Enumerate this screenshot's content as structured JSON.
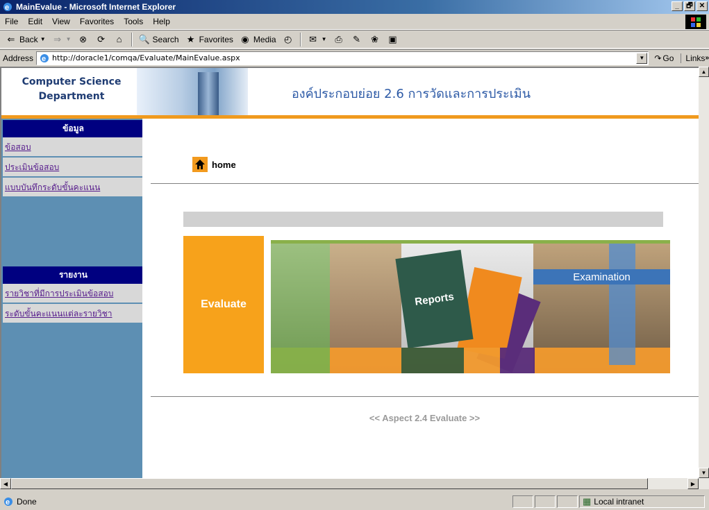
{
  "window": {
    "title": "MainEvalue - Microsoft Internet Explorer",
    "min_label": "_",
    "max_label": "🗗",
    "close_label": "✕"
  },
  "menu": {
    "items": [
      "File",
      "Edit",
      "View",
      "Favorites",
      "Tools",
      "Help"
    ]
  },
  "toolbar": {
    "back": "Back",
    "search": "Search",
    "favorites": "Favorites",
    "media": "Media"
  },
  "address": {
    "label": "Address",
    "url": "http://doracle1/comqa/Evaluate/MainEvalue.aspx",
    "go": "Go",
    "links": "Links"
  },
  "page": {
    "department": "Computer Science\nDepartment",
    "header_title": "องค์ประกอบย่อย 2.6 การวัดและการประเมิน",
    "sidebar": {
      "section1_title": "ข้อมูล",
      "section1_links": [
        "ข้อสอบ",
        "ประเมินข้อสอบ",
        "แบบบันทึกระดับขั้นคะแนน"
      ],
      "section2_title": "รายงาน",
      "section2_links": [
        "รายวิชาที่มีการประเมินข้อสอบ",
        "ระดับขั้นคะแนนแต่ละรายวิชา"
      ]
    },
    "home_label": "home",
    "evaluate_label": "Evaluate",
    "collage": {
      "reports": "Reports",
      "examination": "Examination"
    },
    "aspect_label": "<< Aspect 2.4 Evaluate >>"
  },
  "status": {
    "text": "Done",
    "zone": "Local intranet"
  },
  "colors": {
    "title_bar": "#0a246a",
    "header_orange": "#f09a1e",
    "sidebar_blue": "#5d8fb3",
    "sidebar_title_navy": "#000080",
    "evaluate_orange": "#f7a21b"
  }
}
